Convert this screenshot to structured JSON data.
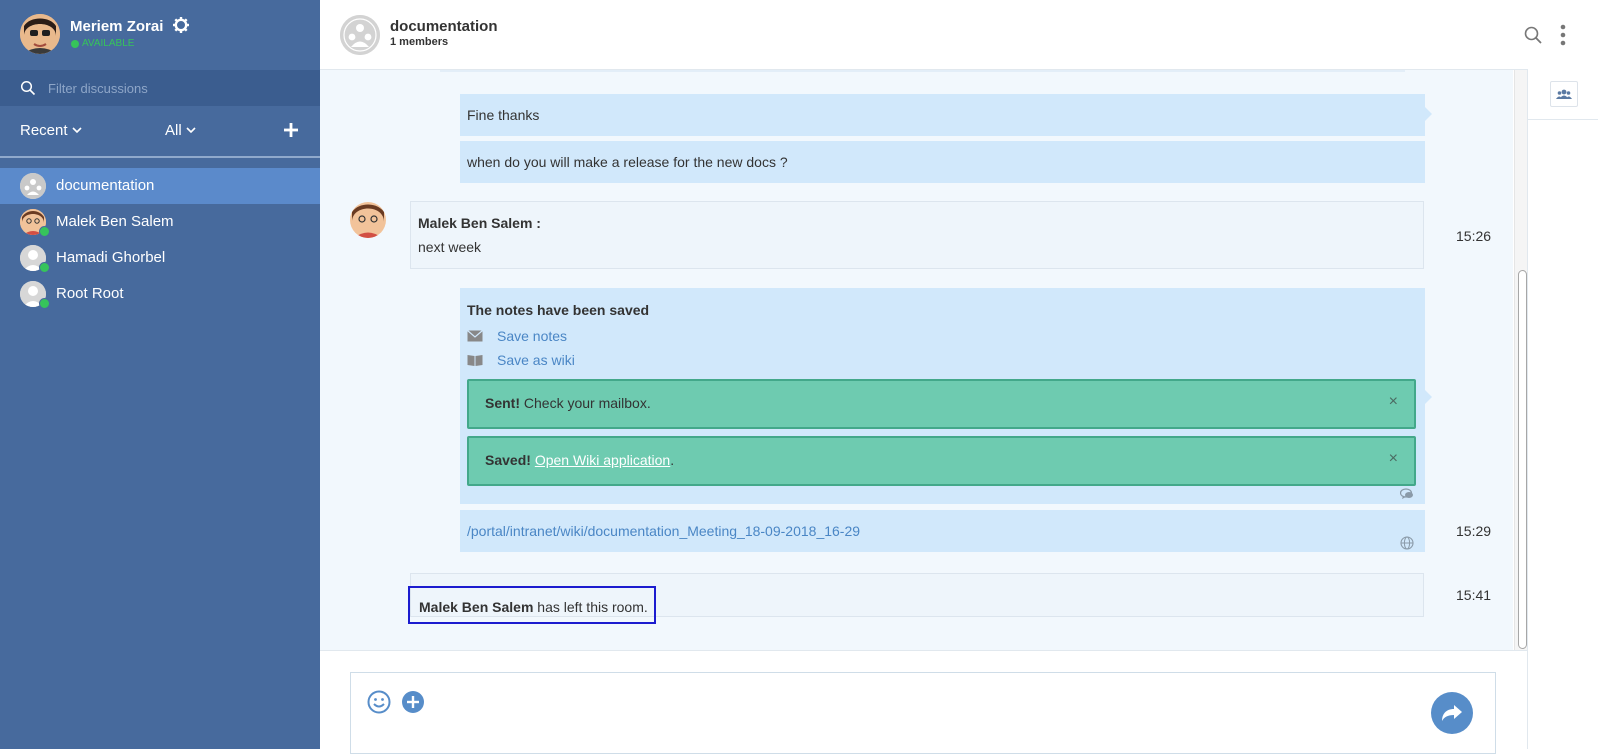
{
  "user": {
    "name": "Meriem Zorai",
    "status": "AVAILABLE"
  },
  "sidebar": {
    "filter_placeholder": "Filter discussions",
    "recent_label": "Recent",
    "all_label": "All",
    "rooms": [
      {
        "name": "documentation",
        "active": true
      },
      {
        "name": "Malek Ben Salem"
      },
      {
        "name": "Hamadi Ghorbel"
      },
      {
        "name": "Root Root"
      }
    ]
  },
  "room": {
    "title": "documentation",
    "members": "1 members"
  },
  "messages": {
    "m1": "Fine thanks",
    "m2": "when do you will make a release for the new docs ?",
    "peer_sender": "Malek Ben Salem :",
    "peer_text": "next week",
    "peer_time": "15:26",
    "notes_title": "The notes have been saved",
    "save_notes": "Save notes",
    "save_wiki": "Save as wiki",
    "sent_strong": "Sent!",
    "sent_text": "Check your mailbox.",
    "saved_strong": "Saved!",
    "saved_link": "Open Wiki application",
    "saved_tail": ".",
    "close_glyph": "×",
    "wiki_path": "/portal/intranet/wiki/documentation_Meeting_18-09-2018_16-29",
    "notes_time": "15:29",
    "left_name": "Malek Ben Salem",
    "left_text": "has left this room.",
    "left_time": "15:41"
  },
  "colors": {
    "sidebar_bg": "#476a9d",
    "active_room": "#5b8acb",
    "bubble_self": "#d1e8fb",
    "alert_bg": "#6ecbb0",
    "online": "#36c45b",
    "send_btn": "#578dc9"
  },
  "icons": [
    "gear-icon",
    "search-icon",
    "menu-dots-icon",
    "plus-icon",
    "chevron-down-icon",
    "envelope-icon",
    "book-icon",
    "comment-icon",
    "web-icon",
    "participants-icon",
    "smiley-icon",
    "add-circle-icon",
    "send-arrow-icon"
  ]
}
